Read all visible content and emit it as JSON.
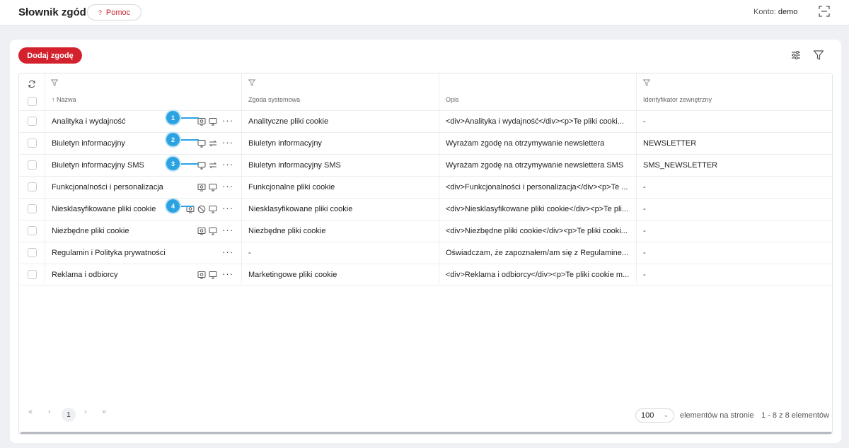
{
  "header": {
    "title": "Słownik zgód",
    "help_label": "Pomoc",
    "account_label": "Konto:",
    "account_value": "demo"
  },
  "toolbar": {
    "add_label": "Dodaj zgodę"
  },
  "table": {
    "columns": [
      "Nazwa",
      "Zgoda systemowa",
      "Opis",
      "Identyfikator zewnętrzny"
    ],
    "rows": [
      {
        "name": "Analityka i wydajność",
        "system": "Analityczne pliki cookie",
        "desc": "<div>Analityka i wydajność</div><p>Te pliki cooki...",
        "ext": "-"
      },
      {
        "name": "Biuletyn informacyjny",
        "system": "Biuletyn informacyjny",
        "desc": "Wyrażam zgodę na otrzymywanie newslettera",
        "ext": "NEWSLETTER"
      },
      {
        "name": "Biuletyn informacyjny SMS",
        "system": "Biuletyn informacyjny SMS",
        "desc": "Wyrażam zgodę na otrzymywanie newslettera SMS",
        "ext": "SMS_NEWSLETTER"
      },
      {
        "name": "Funkcjonalności i personalizacja",
        "system": "Funkcjonalne pliki cookie",
        "desc": "<div>Funkcjonalności i personalizacja</div><p>Te ...",
        "ext": "-"
      },
      {
        "name": "Niesklasyfikowane pliki cookie",
        "system": "Niesklasyfikowane pliki cookie",
        "desc": "<div>Niesklasyfikowane pliki cookie</div><p>Te pli...",
        "ext": "-"
      },
      {
        "name": "Niezbędne pliki cookie",
        "system": "Niezbędne pliki cookie",
        "desc": "<div>Niezbędne pliki cookie</div><p>Te pliki cooki...",
        "ext": "-"
      },
      {
        "name": "Regulamin i Polityka prywatności",
        "system": "-",
        "desc": "Oświadczam, że zapoznałem/am się z Regulamine...",
        "ext": "-"
      },
      {
        "name": "Reklama i odbiorcy",
        "system": "Marketingowe pliki cookie",
        "desc": "<div>Reklama i odbiorcy</div><p>Te pliki cookie m...",
        "ext": "-"
      }
    ]
  },
  "annotations": [
    "1",
    "2",
    "3",
    "4"
  ],
  "pagination": {
    "current_page": "1",
    "page_size": "100",
    "per_page_label": "elementów na stronie",
    "range_label": "1 - 8 z 8 elementów"
  },
  "colors": {
    "accent": "#d3212d",
    "annotation": "#2aa3e0"
  }
}
